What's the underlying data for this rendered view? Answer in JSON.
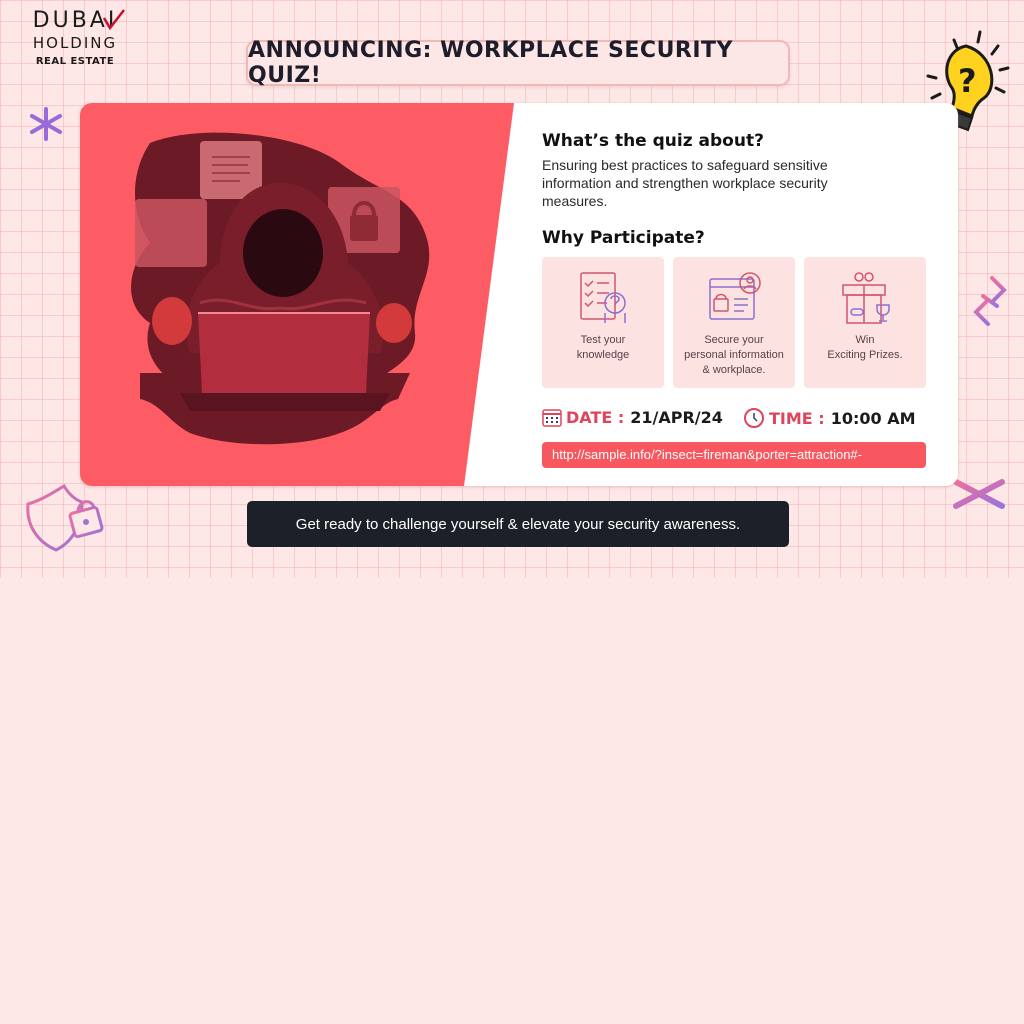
{
  "logo": {
    "line1": "DUBAI",
    "line2": "HOLDING",
    "line3": "REAL ESTATE"
  },
  "title": "ANNOUNCING: WORKPLACE SECURITY QUIZ!",
  "about": {
    "heading": "What’s the quiz about?",
    "lines": [
      "Ensuring best practices to safeguard sensitive",
      "information and strengthen workplace security",
      "measures."
    ]
  },
  "participate": {
    "heading": "Why Participate?",
    "benefits": [
      {
        "icon": "quiz-checklist-icon",
        "lines": [
          "Test your",
          "knowledge"
        ]
      },
      {
        "icon": "secure-profile-icon",
        "lines": [
          "Secure your",
          "personal information",
          "& workplace."
        ]
      },
      {
        "icon": "prize-gift-icon",
        "lines": [
          "Win",
          "Exciting Prizes."
        ]
      }
    ]
  },
  "schedule": {
    "date_label": "DATE :",
    "date_value": "21/APR/24",
    "time_label": "TIME :",
    "time_value": "10:00 AM"
  },
  "link": "http://sample.info/?insect=fireman&porter=attraction#-",
  "footer": "Get ready to challenge yourself & elevate your security awareness.",
  "colors": {
    "accent": "#f9575f",
    "label_red": "#e0445a",
    "background": "#fde8e7",
    "footer_bg": "#1c2029"
  },
  "icons": [
    "lightbulb-question-icon",
    "sparkle-icon",
    "shield-lock-icon",
    "link-chain-icon",
    "hacker-illustration",
    "calendar-icon",
    "clock-icon"
  ]
}
